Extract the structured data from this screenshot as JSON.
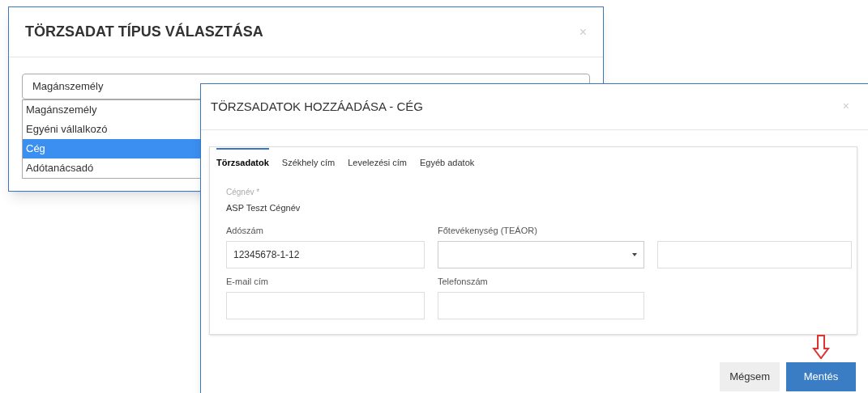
{
  "back_dialog": {
    "title": "TÖRZSADAT TÍPUS VÁLASZTÁSA",
    "close": "×",
    "select": {
      "value": "Magánszemély"
    },
    "options": [
      {
        "label": "Magánszemély",
        "selected": false
      },
      {
        "label": "Egyéni vállalkozó",
        "selected": false
      },
      {
        "label": "Cég",
        "selected": true
      },
      {
        "label": "Adótanácsadó",
        "selected": false
      }
    ]
  },
  "front_dialog": {
    "title": "TÖRZSADATOK HOZZÁADÁSA - CÉG",
    "close": "×",
    "tabs": [
      {
        "label": "Törzsadatok",
        "selected": true
      },
      {
        "label": "Székhely cím",
        "selected": false
      },
      {
        "label": "Levelezési cím",
        "selected": false
      },
      {
        "label": "Egyéb adatok",
        "selected": false
      }
    ],
    "name_label": "Cégnév *",
    "name_value": "ASP Teszt Cégnév",
    "fields": [
      {
        "kind": "text",
        "label": "Adószám",
        "value": "12345678-1-12"
      },
      {
        "kind": "select",
        "label": "Főtevékenység (TEÁOR)"
      },
      {
        "kind": "text"
      },
      {
        "kind": "text",
        "label": "E-mail cím"
      },
      {
        "kind": "text",
        "label": "Telefonszám"
      }
    ],
    "buttons": [
      {
        "label": "Mégsem",
        "kind": "secondary"
      },
      {
        "label": "Mentés",
        "kind": "primary"
      }
    ]
  }
}
